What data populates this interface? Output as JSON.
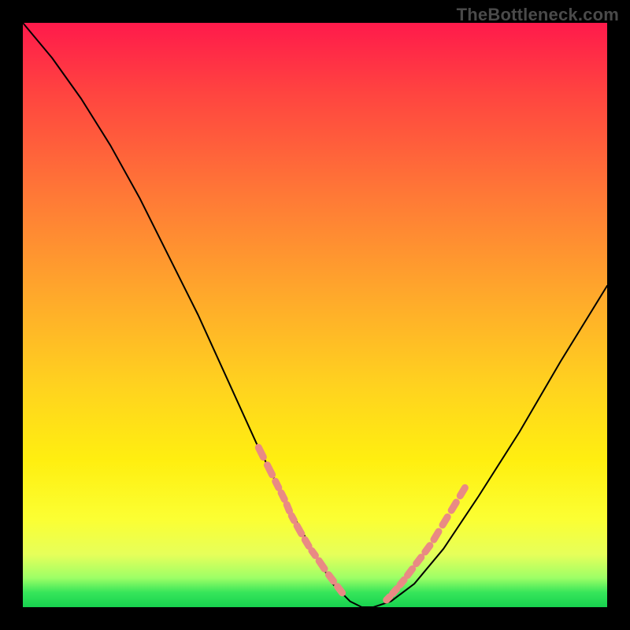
{
  "watermark": "TheBottleneck.com",
  "chart_data": {
    "type": "line",
    "title": "",
    "xlabel": "",
    "ylabel": "",
    "xlim": [
      0,
      100
    ],
    "ylim": [
      0,
      100
    ],
    "grid": false,
    "legend": false,
    "annotations": [],
    "series": [
      {
        "name": "bottleneck-curve",
        "color": "#000000",
        "x": [
          0,
          5,
          10,
          15,
          20,
          25,
          30,
          35,
          40,
          45,
          50,
          53,
          56,
          58,
          60,
          63,
          67,
          72,
          78,
          85,
          92,
          100
        ],
        "y": [
          100,
          94,
          87,
          79,
          70,
          60,
          50,
          39,
          28,
          18,
          9,
          4,
          1,
          0,
          0,
          1,
          4,
          10,
          19,
          30,
          42,
          55
        ]
      },
      {
        "name": "highlight-dashes-left",
        "color": "#e98a84",
        "style": "dashed-segments",
        "x": [
          40,
          41.5,
          43,
          44,
          45,
          45.8,
          46.6,
          48,
          49.2,
          50.3,
          52,
          53.5,
          55
        ],
        "y": [
          28,
          25,
          22,
          20,
          18,
          16,
          14.5,
          12,
          10,
          8.5,
          6,
          4,
          2
        ]
      },
      {
        "name": "highlight-dashes-right",
        "color": "#e98a84",
        "style": "dashed-segments",
        "x": [
          62,
          63,
          64.3,
          65.5,
          67,
          68.5,
          70,
          71.5,
          73,
          74.5,
          76
        ],
        "y": [
          1,
          2,
          3.5,
          5,
          7,
          9,
          11,
          13.5,
          16,
          18.5,
          21
        ]
      }
    ],
    "background_gradient": {
      "orientation": "vertical",
      "stops": [
        {
          "pos": 0.0,
          "color": "#ff1a4b"
        },
        {
          "pos": 0.12,
          "color": "#ff4440"
        },
        {
          "pos": 0.3,
          "color": "#ff7a36"
        },
        {
          "pos": 0.45,
          "color": "#ffa42c"
        },
        {
          "pos": 0.62,
          "color": "#ffd21f"
        },
        {
          "pos": 0.75,
          "color": "#ffef10"
        },
        {
          "pos": 0.85,
          "color": "#fbff33"
        },
        {
          "pos": 0.91,
          "color": "#e6ff5a"
        },
        {
          "pos": 0.95,
          "color": "#9dff66"
        },
        {
          "pos": 0.975,
          "color": "#36e55a"
        },
        {
          "pos": 1.0,
          "color": "#17d24f"
        }
      ]
    }
  },
  "plot_geometry": {
    "inner_left": 29,
    "inner_top": 29,
    "inner_width": 742,
    "inner_height": 742
  }
}
